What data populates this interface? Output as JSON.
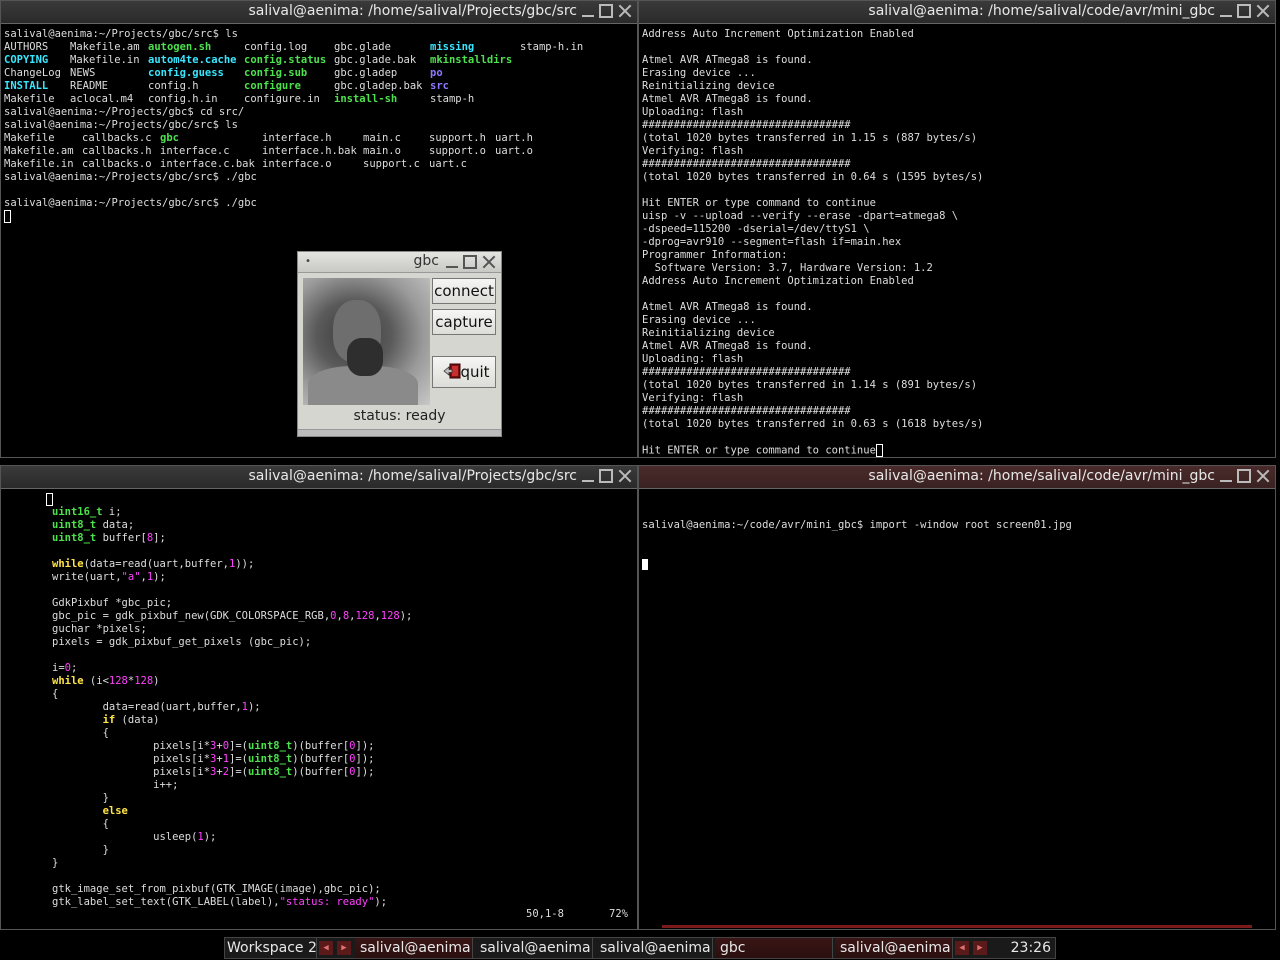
{
  "windows": {
    "top_left": {
      "title": "salival@aenima: /home/salival/Projects/gbc/src",
      "lines_before": [
        "salival@aenima:~/Projects/gbc/src$ ls"
      ],
      "ls1": [
        [
          "AUTHORS",
          "Makefile.am",
          "autogen.sh",
          "config.log",
          "gbc.glade",
          "missing",
          "stamp-h.in"
        ],
        [
          "COPYING",
          "Makefile.in",
          "autom4te.cache",
          "config.status",
          "gbc.glade.bak",
          "mkinstalldirs",
          ""
        ],
        [
          "ChangeLog",
          "NEWS",
          "config.guess",
          "config.sub",
          "gbc.gladep",
          "po",
          ""
        ],
        [
          "INSTALL",
          "README",
          "config.h",
          "configure",
          "gbc.gladep.bak",
          "src",
          ""
        ],
        [
          "Makefile",
          "aclocal.m4",
          "config.h.in",
          "configure.in",
          "install-sh",
          "stamp-h",
          ""
        ]
      ],
      "cmd_cd": "salival@aenima:~/Projects/gbc$ cd src/",
      "cmd_ls2": "salival@aenima:~/Projects/gbc/src$ ls",
      "ls2": [
        [
          "Makefile",
          "callbacks.c",
          "gbc",
          "interface.h",
          "main.c",
          "support.h",
          "uart.h"
        ],
        [
          "Makefile.am",
          "callbacks.h",
          "interface.c",
          "interface.h.bak",
          "main.o",
          "support.o",
          "uart.o"
        ],
        [
          "Makefile.in",
          "callbacks.o",
          "interface.c.bak",
          "interface.o",
          "support.c",
          "uart.c",
          ""
        ]
      ],
      "cmd_run1": "salival@aenima:~/Projects/gbc/src$ ./gbc",
      "cmd_run2": "salival@aenima:~/Projects/gbc/src$ ./gbc"
    },
    "top_right": {
      "title": "salival@aenima: /home/salival/code/avr/mini_gbc",
      "lines": [
        "Address Auto Increment Optimization Enabled",
        "",
        "Atmel AVR ATmega8 is found.",
        "Erasing device ...",
        "Reinitializing device",
        "Atmel AVR ATmega8 is found.",
        "Uploading: flash",
        "#################################",
        "(total 1020 bytes transferred in 1.15 s (887 bytes/s)",
        "Verifying: flash",
        "#################################",
        "(total 1020 bytes transferred in 0.64 s (1595 bytes/s)",
        "",
        "Hit ENTER or type command to continue",
        "uisp -v --upload --verify --erase -dpart=atmega8 \\",
        "-dspeed=115200 -dserial=/dev/ttyS1 \\",
        "-dprog=avr910 --segment=flash if=main.hex",
        "Programmer Information:",
        "  Software Version: 3.7, Hardware Version: 1.2",
        "Address Auto Increment Optimization Enabled",
        "",
        "Atmel AVR ATmega8 is found.",
        "Erasing device ...",
        "Reinitializing device",
        "Atmel AVR ATmega8 is found.",
        "Uploading: flash",
        "#################################",
        "(total 1020 bytes transferred in 1.14 s (891 bytes/s)",
        "Verifying: flash",
        "#################################",
        "(total 1020 bytes transferred in 0.63 s (1618 bytes/s)",
        ""
      ],
      "last_line": "Hit ENTER or type command to continue"
    },
    "bottom_left": {
      "title": "salival@aenima: /home/salival/Projects/gbc/src",
      "code": [
        "uint16_t i;",
        "uint8_t data;",
        "uint8_t buffer[8];",
        "",
        "while(data=read(uart,buffer,1));",
        "write(uart,\"a\",1);",
        "",
        "GdkPixbuf *gbc_pic;",
        "gbc_pic = gdk_pixbuf_new(GDK_COLORSPACE_RGB,0,8,128,128);",
        "guchar *pixels;",
        "pixels = gdk_pixbuf_get_pixels (gbc_pic);",
        "",
        "i=0;",
        "while (i<128*128)",
        "{",
        "        data=read(uart,buffer,1);",
        "        if (data)",
        "        {",
        "                pixels[i*3+0]=(uint8_t)(buffer[0]);",
        "                pixels[i*3+1]=(uint8_t)(buffer[0]);",
        "                pixels[i*3+2]=(uint8_t)(buffer[0]);",
        "                i++;",
        "        }",
        "        else",
        "        {",
        "                usleep(1);",
        "        }",
        "}",
        "",
        "gtk_image_set_from_pixbuf(GTK_IMAGE(image),gbc_pic);",
        "gtk_label_set_text(GTK_LABEL(label),\"status: ready\");"
      ],
      "cursor_pos": "50,1-8",
      "percent": "72%"
    },
    "bottom_right": {
      "title": "salival@aenima: /home/salival/code/avr/mini_gbc",
      "prompt_line": "salival@aenima:~/code/avr/mini_gbc$ import -window root screen01.jpg"
    }
  },
  "gbc_dialog": {
    "title": "gbc",
    "connect_label": "connect",
    "capture_label": "capture",
    "quit_label": "quit",
    "status": "status: ready"
  },
  "taskbar": {
    "workspace": "Workspace 2",
    "items": [
      "salival@aenima",
      "salival@aenima",
      "salival@aenima",
      "gbc",
      "salival@aenima"
    ],
    "clock": "23:26"
  },
  "colors": {
    "dir_blue": "#39e6ff",
    "exec_green": "#4de04d",
    "link_purple": "#8f78ff",
    "vim_type_yellow": "#ffe54a",
    "vim_number_magenta": "#ff40ff"
  }
}
